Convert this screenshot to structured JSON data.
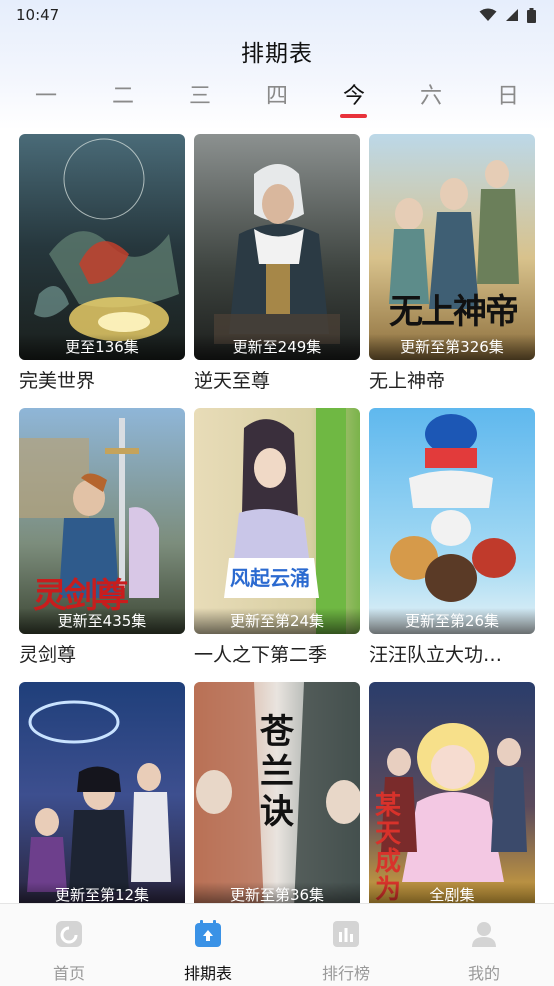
{
  "status_bar": {
    "time": "10:47",
    "icons": [
      "wifi-icon",
      "signal-icon",
      "battery-icon"
    ]
  },
  "header": {
    "title": "排期表"
  },
  "day_tabs": [
    {
      "label": "一",
      "active": false
    },
    {
      "label": "二",
      "active": false
    },
    {
      "label": "三",
      "active": false
    },
    {
      "label": "四",
      "active": false
    },
    {
      "label": "今",
      "active": true
    },
    {
      "label": "六",
      "active": false
    },
    {
      "label": "日",
      "active": false
    }
  ],
  "accent_color": "#e8323b",
  "shows": [
    {
      "title": "完美世界",
      "update": "更至136集"
    },
    {
      "title": "逆天至尊",
      "update": "更新至249集"
    },
    {
      "title": "无上神帝",
      "update": "更新至第326集",
      "poster_text": "无上神帝"
    },
    {
      "title": "灵剑尊",
      "update": "更新至435集",
      "poster_text": "灵剑尊"
    },
    {
      "title": "一人之下第二季",
      "update": "更新至第24集",
      "poster_text": "风起云涌"
    },
    {
      "title": "汪汪队立大功…",
      "update": "更新至第26集"
    },
    {
      "title": "",
      "update": "更新至第12集"
    },
    {
      "title": "",
      "update": "更新至第36集",
      "poster_text": "苍兰诀"
    },
    {
      "title": "",
      "update": "全剧集",
      "poster_text": "某天成为"
    }
  ],
  "bottom_nav": [
    {
      "label": "首页",
      "icon": "home-icon",
      "active": false
    },
    {
      "label": "排期表",
      "icon": "calendar-icon",
      "active": true
    },
    {
      "label": "排行榜",
      "icon": "ranking-icon",
      "active": false
    },
    {
      "label": "我的",
      "icon": "profile-icon",
      "active": false
    }
  ]
}
